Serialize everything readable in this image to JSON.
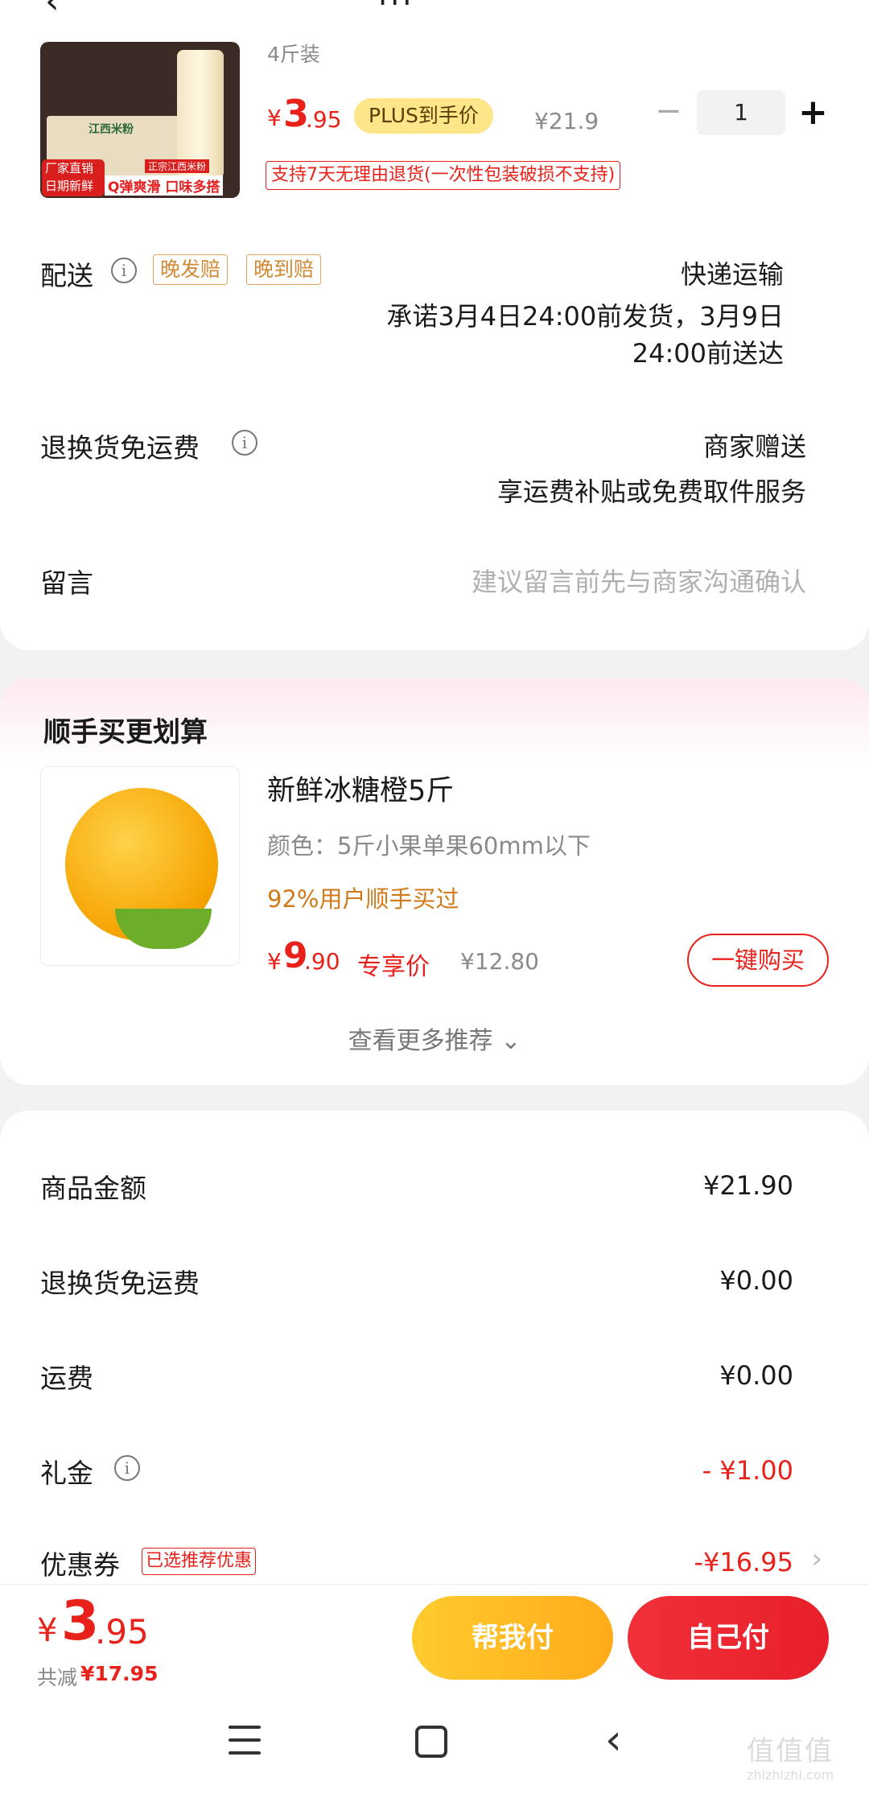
{
  "header": {
    "back_icon": "‹",
    "title": "ııı"
  },
  "product": {
    "spec": "4斤装",
    "price_currency": "¥",
    "price_int": "3",
    "price_dec": ".95",
    "plus_tag": "PLUS到手价",
    "original_price": "¥21.9",
    "qty_minus": "−",
    "quantity": "1",
    "qty_plus": "+",
    "return_policy": "支持7天无理由退货(一次性包装破损不支持)",
    "image_badges": {
      "badge_left": "厂家直销\n日期新鲜",
      "badge_mid": "Q弹爽滑 口味多搭",
      "badge_top": "正宗江西米粉",
      "pack_label": "江西米粉"
    }
  },
  "delivery": {
    "label": "配送",
    "tag_late_ship": "晚发赔",
    "tag_late_arrive": "晚到赔",
    "method": "快递运输",
    "promise_line1": "承诺3月4日24:00前发货，3月9日",
    "promise_line2": "24:00前送达"
  },
  "return_shipping": {
    "label": "退换货免运费",
    "value_line1": "商家赠送",
    "value_line2": "享运费补贴或免费取件服务"
  },
  "message": {
    "label": "留言",
    "placeholder": "建议留言前先与商家沟通确认"
  },
  "recommend": {
    "title": "顺手买更划算",
    "name": "新鲜冰糖橙5斤",
    "spec": "颜色：5斤小果单果60mm以下",
    "social": "92%用户顺手买过",
    "price_currency": "¥",
    "price_int": "9",
    "price_dec": ".90",
    "exclusive": "专享价",
    "original_price": "¥12.80",
    "buy_button": "一键购买",
    "more": "查看更多推荐 ⌄"
  },
  "summary": {
    "goods_label": "商品金额",
    "goods_value": "¥21.90",
    "return_label": "退换货免运费",
    "return_value": "¥0.00",
    "shipping_label": "运费",
    "shipping_value": "¥0.00",
    "gift_label": "礼金",
    "gift_value": "- ¥1.00",
    "coupon_label": "优惠券",
    "coupon_tag": "已选推荐优惠",
    "coupon_value": "-¥16.95",
    "coupon_arrow": "›"
  },
  "bottom": {
    "total_currency": "¥",
    "total_int": "3",
    "total_dec": ".95",
    "saved_label": "共减",
    "saved_value": "¥17.95",
    "help_pay": "帮我付",
    "self_pay": "自己付"
  },
  "nav": {
    "back_icon": "‹"
  },
  "watermark": {
    "text": "值值值",
    "url": "zhizhizhi.com"
  },
  "colors": {
    "accent_red": "#e8221b",
    "plus_gold": "#fde58a",
    "help_pay_yellow": "#ffb820",
    "tag_orange": "#d08a34"
  }
}
